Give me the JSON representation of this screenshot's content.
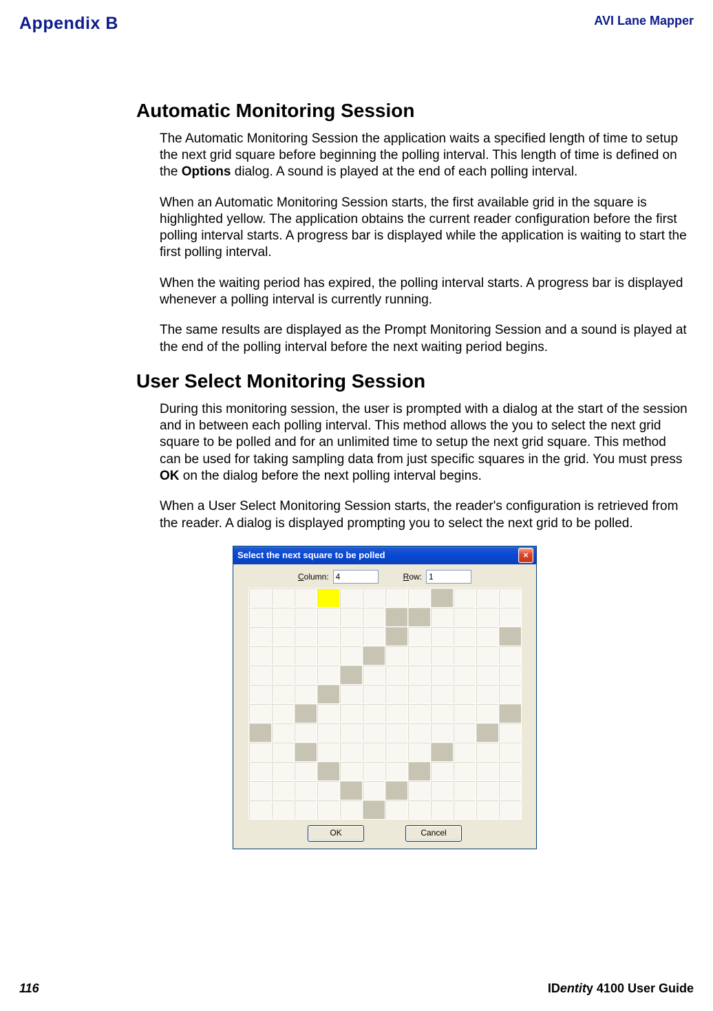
{
  "header": {
    "appendix": "Appendix B",
    "doc_title": "AVI Lane Mapper"
  },
  "sections": {
    "auto": {
      "heading": "Automatic Monitoring Session",
      "p1a": "The Automatic Monitoring Session the application waits a specified length of time to setup the next grid square before beginning the polling interval. This length of time is defined on the ",
      "p1_bold": "Options",
      "p1b": " dialog. A sound is played at the end of each polling interval.",
      "p2": "When an Automatic Monitoring Session starts, the first available grid in the square is highlighted yellow. The application obtains the current reader configuration before the first polling interval starts. A progress bar is displayed while the application is waiting to start the first polling interval.",
      "p3": "When the waiting period has expired, the polling interval starts. A progress bar is displayed whenever a polling interval is currently running.",
      "p4": "The same results are displayed as the Prompt Monitoring Session and a sound is played at the end of the polling interval before the next waiting period begins."
    },
    "user": {
      "heading": "User Select Monitoring Session",
      "p1a": "During this monitoring session, the user is prompted with a dialog at the start of the session and in between each polling interval. This method allows the you to select the next grid square to be polled and for an unlimited time to setup the next grid square. This method can be used for taking sampling data from just specific squares in the grid. You must press ",
      "p1_bold": "OK",
      "p1b": " on the dialog before the next polling interval begins.",
      "p2": "When a User Select Monitoring Session starts, the reader's configuration is retrieved from the reader. A dialog is displayed prompting you to select the next grid to be polled."
    }
  },
  "dialog": {
    "title": "Select the next square to be polled",
    "column_label_pre": "C",
    "column_label_post": "olumn:",
    "column_value": "4",
    "row_label_pre": "R",
    "row_label_post": "ow:",
    "row_value": "1",
    "ok": "OK",
    "cancel": "Cancel",
    "close_glyph": "×",
    "grid_rows": 12,
    "grid_cols": 12,
    "yellow_cell": [
      0,
      3
    ],
    "dark_cells": [
      [
        0,
        8
      ],
      [
        1,
        6
      ],
      [
        1,
        7
      ],
      [
        2,
        6
      ],
      [
        2,
        11
      ],
      [
        3,
        5
      ],
      [
        4,
        4
      ],
      [
        5,
        3
      ],
      [
        6,
        2
      ],
      [
        6,
        11
      ],
      [
        7,
        0
      ],
      [
        7,
        10
      ],
      [
        8,
        2
      ],
      [
        8,
        8
      ],
      [
        9,
        3
      ],
      [
        9,
        7
      ],
      [
        10,
        4
      ],
      [
        10,
        6
      ],
      [
        11,
        5
      ]
    ]
  },
  "footer": {
    "page_number": "116",
    "guide": "IDentity 4100 User Guide"
  }
}
